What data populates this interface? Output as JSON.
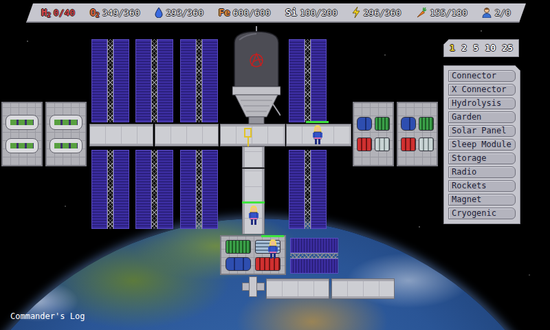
{
  "resources": [
    {
      "kind": "text",
      "label": "H",
      "sub": "2",
      "value": "0/40",
      "warning": true,
      "color": "#e04848"
    },
    {
      "kind": "text",
      "label": "O",
      "sub": "2",
      "value": "349/360",
      "warning": false,
      "color": "#e06a3a"
    },
    {
      "kind": "drop",
      "value": "293/360",
      "warning": false
    },
    {
      "kind": "text",
      "label": "Fe",
      "value": "600/600",
      "warning": false,
      "color": "#e08a3a"
    },
    {
      "kind": "text",
      "label": "Si",
      "value": "100/200",
      "warning": false,
      "color": "#eeeef2"
    },
    {
      "kind": "bolt",
      "value": "296/360",
      "warning": false
    },
    {
      "kind": "carrot",
      "value": "155/180",
      "warning": false
    },
    {
      "kind": "person",
      "value": "2/0",
      "warning": false
    }
  ],
  "speed": [
    {
      "label": "1",
      "selected": true
    },
    {
      "label": "2",
      "selected": false
    },
    {
      "label": "5",
      "selected": false
    },
    {
      "label": "10",
      "selected": false
    },
    {
      "label": "25",
      "selected": false
    }
  ],
  "build_menu": [
    "Connector",
    "X Connector",
    "Hydrolysis",
    "Garden",
    "Solar Panel",
    "Sleep Module",
    "Storage",
    "Radio",
    "Rockets",
    "Magnet",
    "Cryogenic"
  ],
  "station": {
    "modules": [
      {
        "kind": "solar-v"
      },
      {
        "kind": "solar-v"
      },
      {
        "kind": "solar-v"
      },
      {
        "kind": "solar-v"
      },
      {
        "kind": "solar-v"
      },
      {
        "kind": "solar-v"
      },
      {
        "kind": "solar-v"
      },
      {
        "kind": "solar-v"
      },
      {
        "kind": "solar-h"
      },
      {
        "kind": "garden"
      },
      {
        "kind": "garden"
      },
      {
        "kind": "storage"
      },
      {
        "kind": "storage"
      },
      {
        "kind": "connector-h"
      },
      {
        "kind": "connector-h"
      },
      {
        "kind": "hub"
      },
      {
        "kind": "connector-h"
      },
      {
        "kind": "rocket"
      },
      {
        "kind": "connector-v"
      },
      {
        "kind": "connector-v"
      },
      {
        "kind": "mixed"
      },
      {
        "kind": "xconn"
      },
      {
        "kind": "connector-h"
      },
      {
        "kind": "connector-h"
      }
    ],
    "crew": [
      {
        "level": 1.0
      },
      {
        "level": 1.0
      },
      {
        "level": 1.0
      }
    ]
  },
  "commanders_log": "Commander's Log"
}
